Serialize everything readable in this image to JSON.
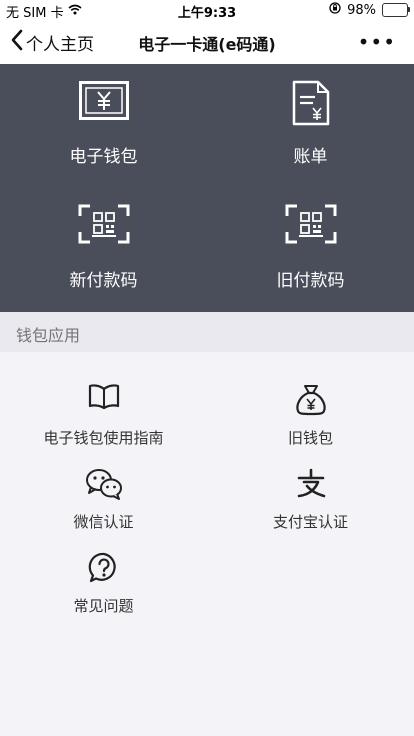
{
  "status_bar": {
    "carrier": "无 SIM 卡",
    "time": "上午9:33",
    "battery_percent": "98%",
    "battery_level": 0.98,
    "battery_color": "#34c759"
  },
  "nav": {
    "back_label": "个人主页",
    "title": "电子一卡通(e码通)",
    "more_label": "•••"
  },
  "cards": [
    {
      "label": "电子钱包",
      "icon": "yuan-card-icon"
    },
    {
      "label": "账单",
      "icon": "bill-document-icon"
    },
    {
      "label": "新付款码",
      "icon": "qr-scan-icon"
    },
    {
      "label": "旧付款码",
      "icon": "qr-scan-icon"
    }
  ],
  "section": {
    "title": "钱包应用"
  },
  "apps": [
    {
      "label": "电子钱包使用指南",
      "icon": "book-icon"
    },
    {
      "label": "旧钱包",
      "icon": "money-bag-icon"
    },
    {
      "label": "微信认证",
      "icon": "wechat-icon"
    },
    {
      "label": "支付宝认证",
      "icon": "alipay-icon"
    },
    {
      "label": "常见问题",
      "icon": "question-bubble-icon"
    }
  ],
  "colors": {
    "panel_bg": "#4a4e5a",
    "section_bg": "#e9e9ef",
    "page_bg": "#f4f4f8"
  }
}
